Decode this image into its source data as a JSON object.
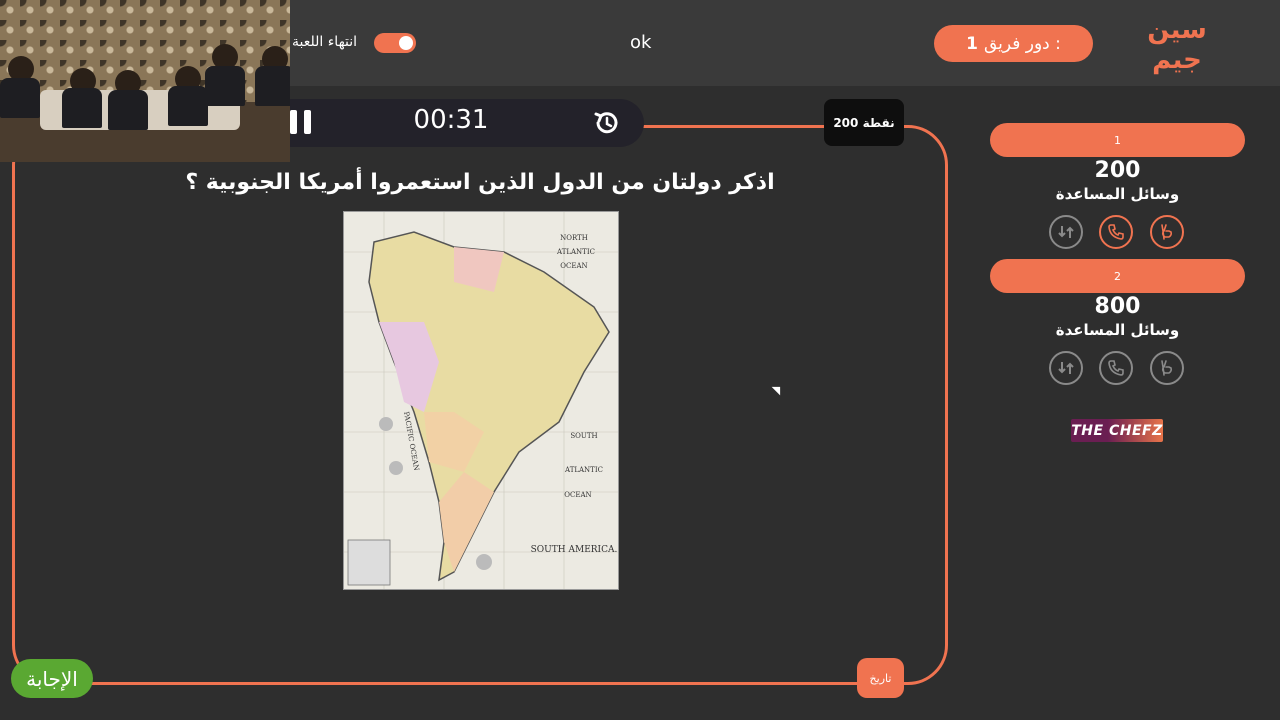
{
  "header": {
    "exit_game_label": "انتهاء اللعبة",
    "status_text": "ok",
    "turn_label": "دور فريق :",
    "turn_team": "1",
    "logo_text": "سين جيم"
  },
  "controls": {
    "timer": "00:31",
    "points_badge": "200 نقطة"
  },
  "question": {
    "text": "اذكر دولتان من الدول الذين استعمروا أمريكا الجنوبية ؟",
    "image": {
      "map_title": "SOUTH AMERICA.",
      "north_ocean_1": "NORTH",
      "north_ocean_2": "ATLANTIC",
      "north_ocean_3": "OCEAN",
      "south_ocean_1": "SOUTH",
      "south_ocean_2": "ATLANTIC",
      "south_ocean_3": "OCEAN",
      "pacific": "PACIFIC OCEAN"
    },
    "answer_button": "الإجابة",
    "category_tag": "تاريخ"
  },
  "teams": [
    {
      "label": "1",
      "score": "200",
      "aids_label": "وسائل المساعدة"
    },
    {
      "label": "2",
      "score": "800",
      "aids_label": "وسائل المساعدة"
    }
  ],
  "sponsor": {
    "text": "THE CHEFZ"
  },
  "colors": {
    "accent": "#f07350",
    "background": "#2e2e2e",
    "topbar": "#3a3a3a",
    "answer": "#5aa832"
  }
}
